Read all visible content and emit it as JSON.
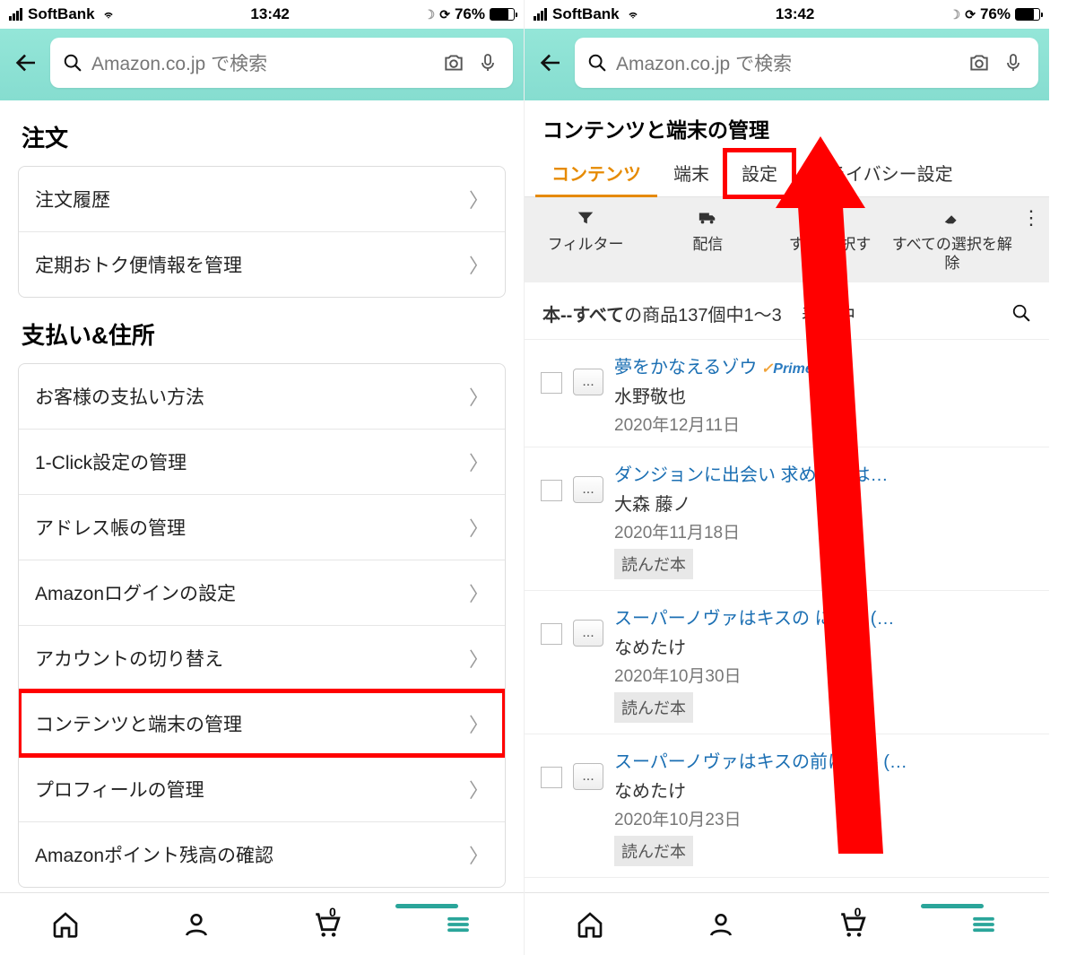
{
  "status": {
    "carrier": "SoftBank",
    "time": "13:42",
    "battery": "76%"
  },
  "search": {
    "placeholder": "Amazon.co.jp で検索"
  },
  "left": {
    "sections": [
      {
        "title": "注文",
        "items": [
          "注文履歴",
          "定期おトク便情報を管理"
        ]
      },
      {
        "title": "支払い&住所",
        "items": [
          "お客様の支払い方法",
          "1-Click設定の管理",
          "アドレス帳の管理",
          "Amazonログインの設定",
          "アカウントの切り替え",
          "コンテンツと端末の管理",
          "プロフィールの管理",
          "Amazonポイント残高の確認"
        ],
        "highlight_index": 5
      }
    ]
  },
  "right": {
    "page_title": "コンテンツと端末の管理",
    "tabs": [
      "コンテンツ",
      "端末",
      "設定",
      "プライバシー設定"
    ],
    "active_tab": 0,
    "boxed_tab": 2,
    "toolbar": {
      "filter": "フィルター",
      "deliver": "配信",
      "select_all_1": "す",
      "select_all_2": "選択す",
      "deselect": "すべての選択を解除",
      "more": "⋮"
    },
    "results": {
      "prefix_bold": "本--すべて",
      "rest": "の商品137個中1〜3",
      "rest_tail": "表示中"
    },
    "items": [
      {
        "title": "夢をかなえるゾウ",
        "prime": true,
        "author": "水野敬也",
        "date": "2020年12月11日",
        "tag": null
      },
      {
        "title": "ダンジョンに出会い",
        "title_tail": "求めるのは…",
        "author": "大森 藤ノ",
        "date": "2020年11月18日",
        "tag": "読んだ本"
      },
      {
        "title": "スーパーノヴァはキスの",
        "title_tail": "に 2巻 (…",
        "author": "なめたけ",
        "date": "2020年10月30日",
        "tag": "読んだ本"
      },
      {
        "title": "スーパーノヴァはキスの前に",
        "title_tail": "1巻 (…",
        "author": "なめたけ",
        "date": "2020年10月23日",
        "tag": "読んだ本"
      }
    ],
    "cart_badge": "0"
  }
}
